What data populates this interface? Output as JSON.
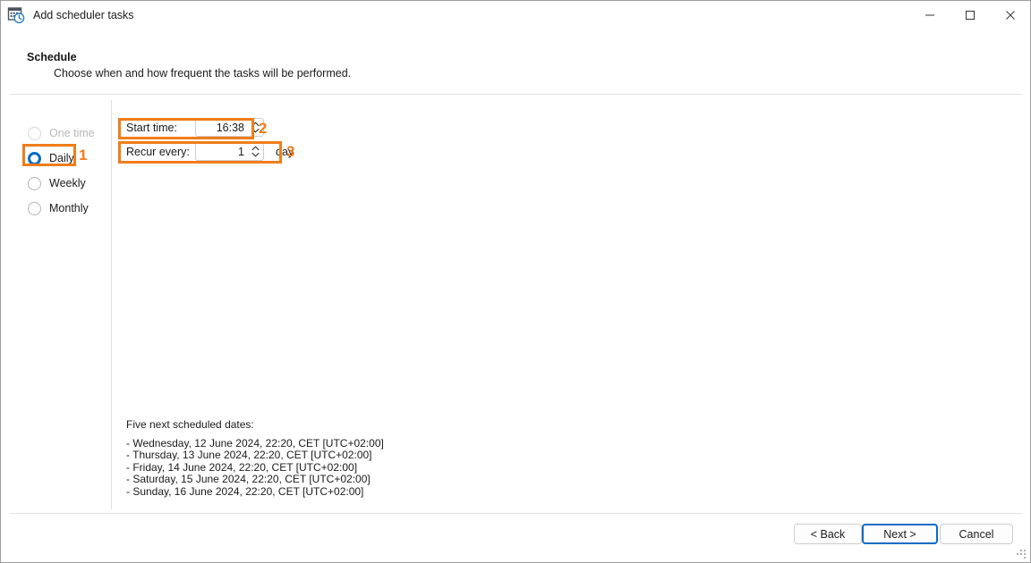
{
  "window": {
    "title": "Add scheduler tasks",
    "app_icon": "calendar-clock-icon",
    "controls": {
      "minimize": "minimize-icon",
      "maximize": "maximize-icon",
      "close": "close-icon"
    }
  },
  "header": {
    "title": "Schedule",
    "subtitle": "Choose when and how frequent the tasks will be performed."
  },
  "schedule_modes": [
    {
      "label": "One time",
      "checked": false,
      "disabled": true
    },
    {
      "label": "Daily",
      "checked": true,
      "disabled": false
    },
    {
      "label": "Weekly",
      "checked": false,
      "disabled": false
    },
    {
      "label": "Monthly",
      "checked": false,
      "disabled": false
    }
  ],
  "form": {
    "start_time": {
      "label": "Start time:",
      "value": "16:38"
    },
    "recur_every": {
      "label": "Recur every:",
      "value": "1",
      "unit": "day"
    }
  },
  "preview": {
    "title": "Five next scheduled dates:",
    "items": [
      "- Wednesday, 12 June 2024, 22:20, CET [UTC+02:00]",
      "- Thursday, 13 June 2024, 22:20, CET [UTC+02:00]",
      "- Friday, 14 June 2024, 22:20, CET [UTC+02:00]",
      "- Saturday, 15 June 2024, 22:20, CET [UTC+02:00]",
      "- Sunday, 16 June 2024, 22:20, CET [UTC+02:00]"
    ]
  },
  "footer": {
    "back_label": "< Back",
    "next_label": "Next >",
    "cancel_label": "Cancel"
  },
  "annotations": {
    "color": "#f07d1a",
    "markers": [
      {
        "number": "1",
        "target": "daily-radio-option"
      },
      {
        "number": "2",
        "target": "start-time-field"
      },
      {
        "number": "3",
        "target": "recur-every-field"
      }
    ]
  }
}
